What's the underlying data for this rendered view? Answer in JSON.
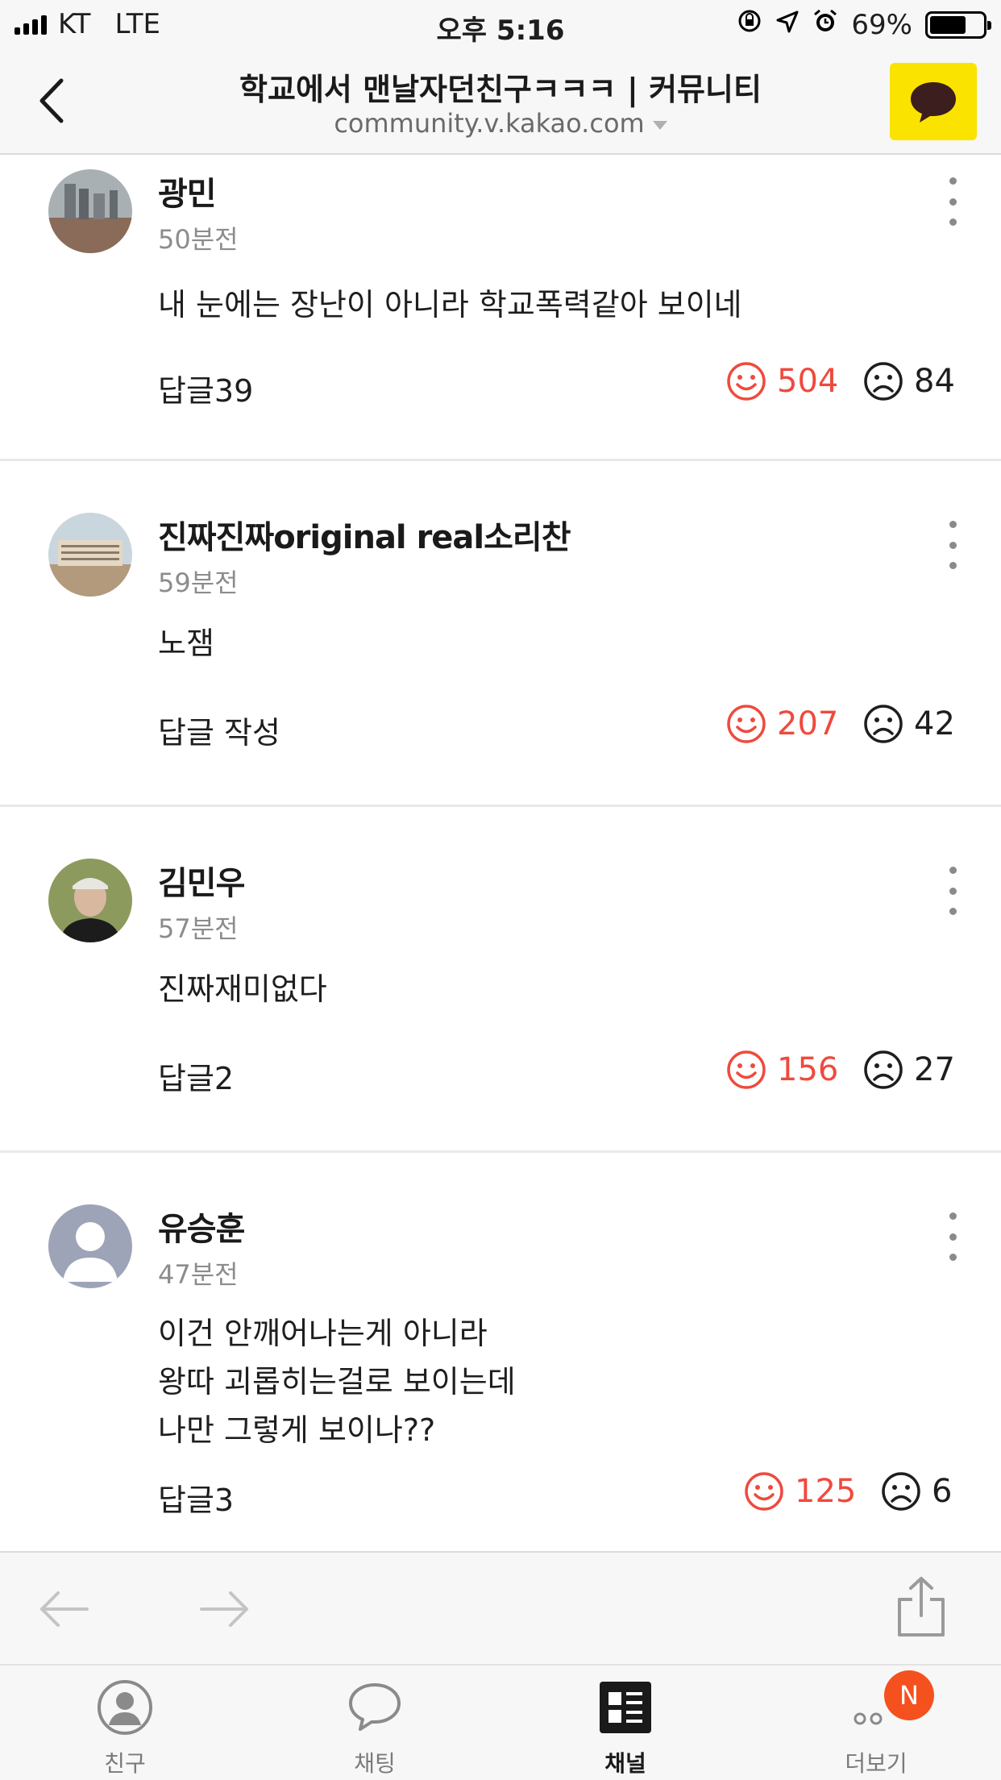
{
  "status": {
    "carrier": "KT",
    "network": "LTE",
    "time": "오후 5:16",
    "battery": "69%",
    "battery_level": 0.69
  },
  "header": {
    "title": "학교에서 맨날자던친구ㅋㅋㅋ | 커뮤니티",
    "url": "community.v.kakao.com"
  },
  "comments": [
    {
      "author": "광민",
      "time": "50분전",
      "body": [
        "내 눈에는  장난이 아니라 학교폭력같아 보이네"
      ],
      "reply": "답글39",
      "likes": "504",
      "dislikes": "84"
    },
    {
      "author": "진짜진짜original real소리찬",
      "time": "59분전",
      "body": [
        "노잼"
      ],
      "reply": "답글 작성",
      "likes": "207",
      "dislikes": "42"
    },
    {
      "author": "김민우",
      "time": "57분전",
      "body": [
        "진짜재미없다"
      ],
      "reply": "답글2",
      "likes": "156",
      "dislikes": "27"
    },
    {
      "author": "유승훈",
      "time": "47분전",
      "body": [
        "이건 안깨어나는게 아니라",
        "왕따 괴롭히는걸로 보이는데",
        "나만 그렇게 보이나??"
      ],
      "reply": "답글3",
      "likes": "125",
      "dislikes": "6"
    }
  ],
  "tabs": [
    {
      "label": "친구",
      "icon": "person-icon"
    },
    {
      "label": "채팅",
      "icon": "chat-bubble-icon"
    },
    {
      "label": "채널",
      "icon": "channel-icon"
    },
    {
      "label": "더보기",
      "icon": "more-dots-icon"
    }
  ],
  "badge": "N",
  "colors": {
    "accent_like": "#ef4a3e",
    "kakao_yellow": "#fbe300",
    "badge": "#f4511e"
  }
}
